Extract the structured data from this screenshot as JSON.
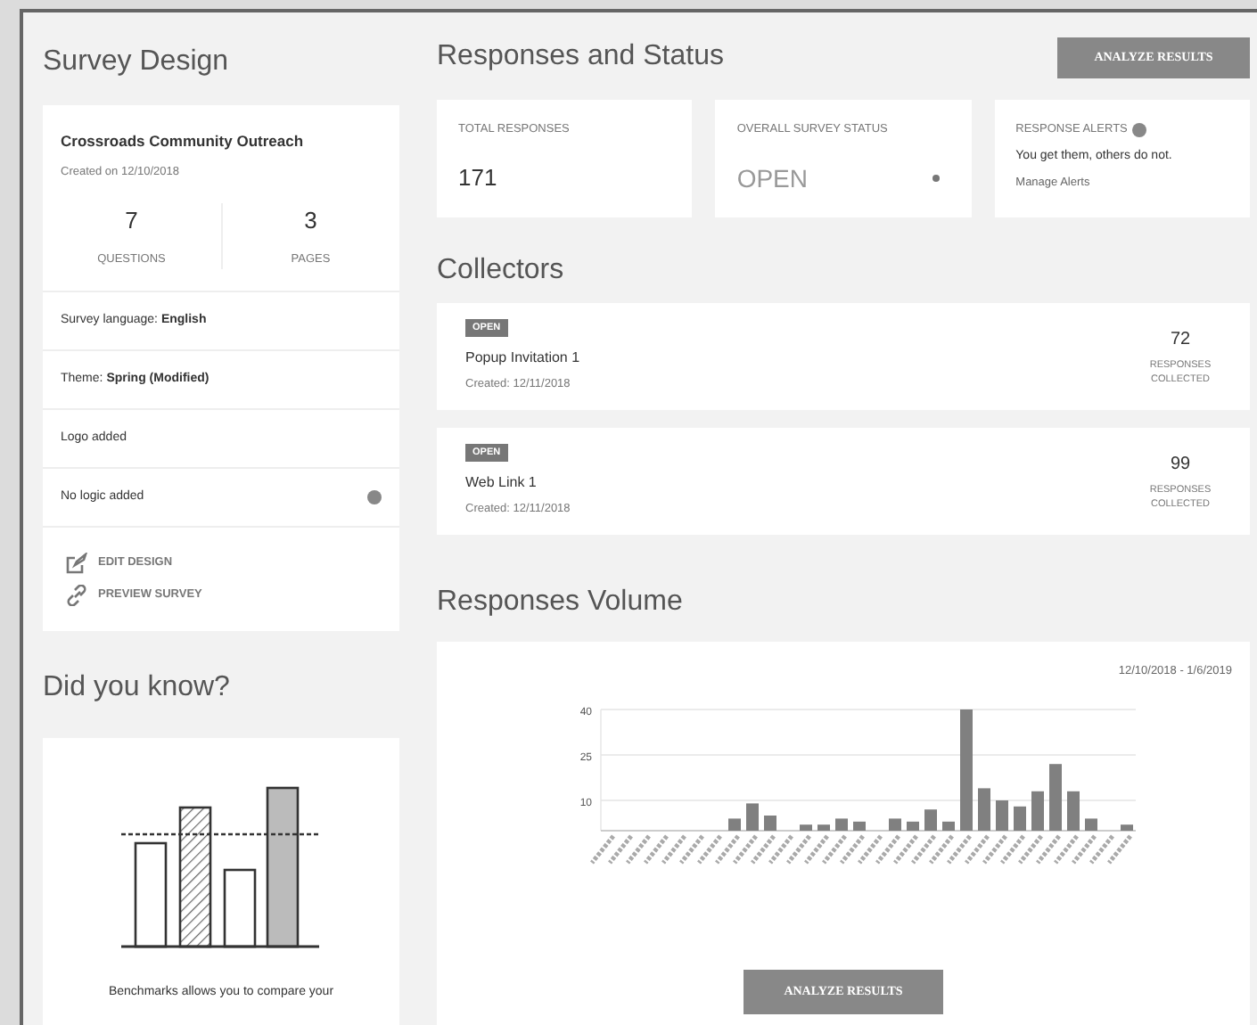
{
  "survey_design": {
    "title": "Survey Design",
    "survey_name": "Crossroads Community Outreach",
    "created": "Created on 12/10/2018",
    "stats": [
      {
        "value": "7",
        "label": "QUESTIONS"
      },
      {
        "value": "3",
        "label": "PAGES"
      }
    ],
    "details": [
      {
        "text": "Survey language: **English**",
        "info": false
      },
      {
        "text": "Theme: **Spring (Modified)**",
        "info": false
      },
      {
        "text": "Logo added",
        "info": false
      },
      {
        "text": "No logic added",
        "info": true
      }
    ],
    "links": [
      {
        "kind": "edit",
        "label": "EDIT DESIGN"
      },
      {
        "kind": "preview",
        "label": "PREVIEW SURVEY"
      }
    ]
  },
  "did_you_know": {
    "title": "Did you know?",
    "text": "Benchmarks allows you to compare your"
  },
  "responses_status": {
    "title": "Responses and Status",
    "button": "ANALYZE RESULTS",
    "cards": [
      {
        "kind": "value",
        "label": "TOTAL RESPONSES",
        "value": "171"
      },
      {
        "kind": "dropdown",
        "label": "OVERALL SURVEY STATUS",
        "value": "OPEN"
      },
      {
        "kind": "alerts",
        "label": "RESPONSE ALERTS",
        "text": "You get them, others do not.",
        "link": "Manage Alerts"
      }
    ]
  },
  "collectors": {
    "title": "Collectors",
    "items": [
      {
        "badge": "OPEN",
        "name": "Popup Invitation 1",
        "created": "Created: 12/11/2018",
        "count": "72",
        "count_label": "RESPONSES COLLECTED"
      },
      {
        "badge": "OPEN",
        "name": "Web Link 1",
        "created": "Created: 12/11/2018",
        "count": "99",
        "count_label": "RESPONSES COLLECTED"
      }
    ]
  },
  "responses_volume": {
    "title": "Responses Volume",
    "date_range": "12/10/2018 - 1/6/2019",
    "button": "ANALYZE RESULTS",
    "chart_data": {
      "type": "bar",
      "ylim": [
        0,
        40
      ],
      "yticks": [
        10,
        25,
        40
      ],
      "grid": true,
      "series": [
        {
          "color": "#808080",
          "values": [
            0,
            0,
            0,
            0,
            0,
            0,
            0,
            4,
            9,
            5,
            0,
            2,
            2,
            4,
            3,
            0,
            4,
            3,
            7,
            3,
            40,
            14,
            10,
            8,
            13,
            22,
            13,
            4,
            0,
            2
          ]
        }
      ]
    }
  }
}
